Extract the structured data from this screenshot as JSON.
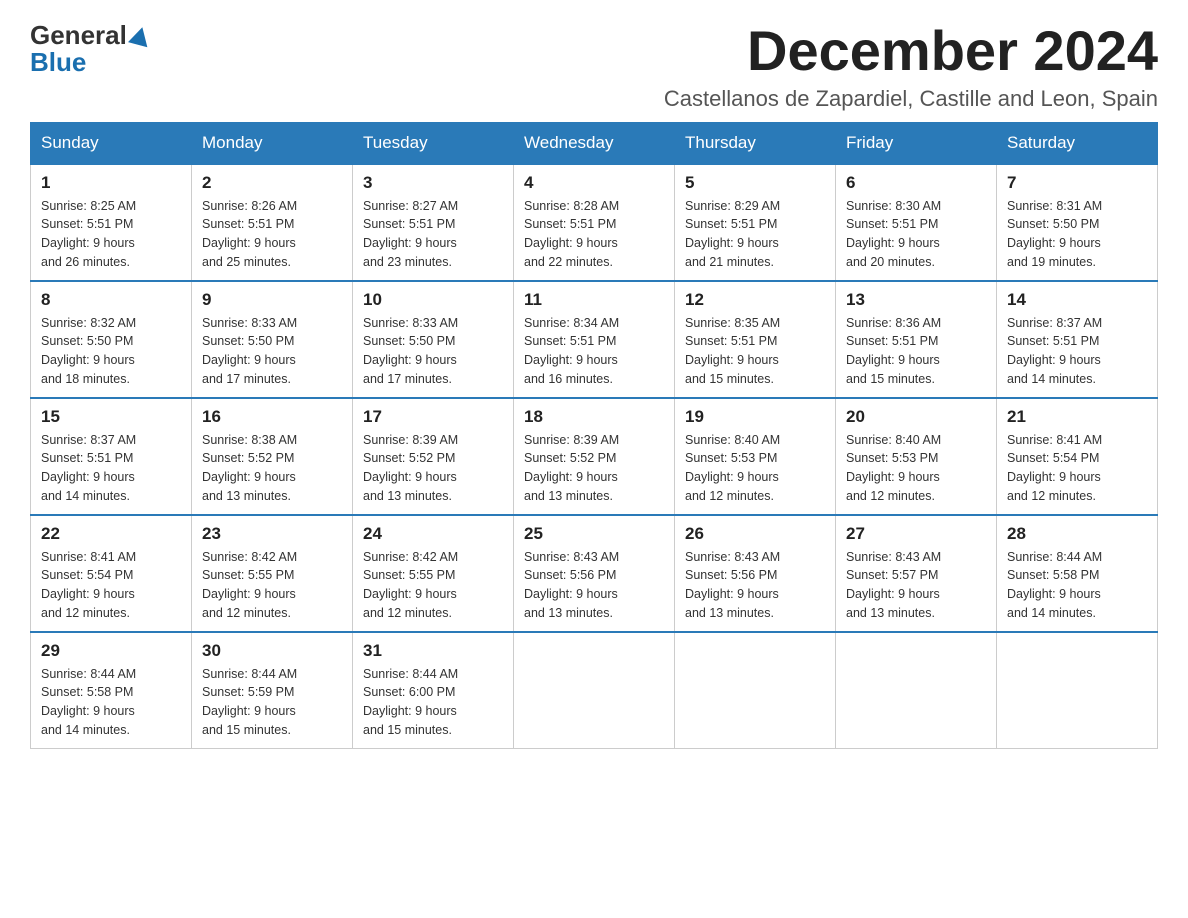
{
  "logo": {
    "general": "General",
    "blue": "Blue"
  },
  "header": {
    "month": "December 2024",
    "location": "Castellanos de Zapardiel, Castille and Leon, Spain"
  },
  "days_of_week": [
    "Sunday",
    "Monday",
    "Tuesday",
    "Wednesday",
    "Thursday",
    "Friday",
    "Saturday"
  ],
  "weeks": [
    [
      {
        "day": "1",
        "sunrise": "8:25 AM",
        "sunset": "5:51 PM",
        "daylight": "9 hours and 26 minutes."
      },
      {
        "day": "2",
        "sunrise": "8:26 AM",
        "sunset": "5:51 PM",
        "daylight": "9 hours and 25 minutes."
      },
      {
        "day": "3",
        "sunrise": "8:27 AM",
        "sunset": "5:51 PM",
        "daylight": "9 hours and 23 minutes."
      },
      {
        "day": "4",
        "sunrise": "8:28 AM",
        "sunset": "5:51 PM",
        "daylight": "9 hours and 22 minutes."
      },
      {
        "day": "5",
        "sunrise": "8:29 AM",
        "sunset": "5:51 PM",
        "daylight": "9 hours and 21 minutes."
      },
      {
        "day": "6",
        "sunrise": "8:30 AM",
        "sunset": "5:51 PM",
        "daylight": "9 hours and 20 minutes."
      },
      {
        "day": "7",
        "sunrise": "8:31 AM",
        "sunset": "5:50 PM",
        "daylight": "9 hours and 19 minutes."
      }
    ],
    [
      {
        "day": "8",
        "sunrise": "8:32 AM",
        "sunset": "5:50 PM",
        "daylight": "9 hours and 18 minutes."
      },
      {
        "day": "9",
        "sunrise": "8:33 AM",
        "sunset": "5:50 PM",
        "daylight": "9 hours and 17 minutes."
      },
      {
        "day": "10",
        "sunrise": "8:33 AM",
        "sunset": "5:50 PM",
        "daylight": "9 hours and 17 minutes."
      },
      {
        "day": "11",
        "sunrise": "8:34 AM",
        "sunset": "5:51 PM",
        "daylight": "9 hours and 16 minutes."
      },
      {
        "day": "12",
        "sunrise": "8:35 AM",
        "sunset": "5:51 PM",
        "daylight": "9 hours and 15 minutes."
      },
      {
        "day": "13",
        "sunrise": "8:36 AM",
        "sunset": "5:51 PM",
        "daylight": "9 hours and 15 minutes."
      },
      {
        "day": "14",
        "sunrise": "8:37 AM",
        "sunset": "5:51 PM",
        "daylight": "9 hours and 14 minutes."
      }
    ],
    [
      {
        "day": "15",
        "sunrise": "8:37 AM",
        "sunset": "5:51 PM",
        "daylight": "9 hours and 14 minutes."
      },
      {
        "day": "16",
        "sunrise": "8:38 AM",
        "sunset": "5:52 PM",
        "daylight": "9 hours and 13 minutes."
      },
      {
        "day": "17",
        "sunrise": "8:39 AM",
        "sunset": "5:52 PM",
        "daylight": "9 hours and 13 minutes."
      },
      {
        "day": "18",
        "sunrise": "8:39 AM",
        "sunset": "5:52 PM",
        "daylight": "9 hours and 13 minutes."
      },
      {
        "day": "19",
        "sunrise": "8:40 AM",
        "sunset": "5:53 PM",
        "daylight": "9 hours and 12 minutes."
      },
      {
        "day": "20",
        "sunrise": "8:40 AM",
        "sunset": "5:53 PM",
        "daylight": "9 hours and 12 minutes."
      },
      {
        "day": "21",
        "sunrise": "8:41 AM",
        "sunset": "5:54 PM",
        "daylight": "9 hours and 12 minutes."
      }
    ],
    [
      {
        "day": "22",
        "sunrise": "8:41 AM",
        "sunset": "5:54 PM",
        "daylight": "9 hours and 12 minutes."
      },
      {
        "day": "23",
        "sunrise": "8:42 AM",
        "sunset": "5:55 PM",
        "daylight": "9 hours and 12 minutes."
      },
      {
        "day": "24",
        "sunrise": "8:42 AM",
        "sunset": "5:55 PM",
        "daylight": "9 hours and 12 minutes."
      },
      {
        "day": "25",
        "sunrise": "8:43 AM",
        "sunset": "5:56 PM",
        "daylight": "9 hours and 13 minutes."
      },
      {
        "day": "26",
        "sunrise": "8:43 AM",
        "sunset": "5:56 PM",
        "daylight": "9 hours and 13 minutes."
      },
      {
        "day": "27",
        "sunrise": "8:43 AM",
        "sunset": "5:57 PM",
        "daylight": "9 hours and 13 minutes."
      },
      {
        "day": "28",
        "sunrise": "8:44 AM",
        "sunset": "5:58 PM",
        "daylight": "9 hours and 14 minutes."
      }
    ],
    [
      {
        "day": "29",
        "sunrise": "8:44 AM",
        "sunset": "5:58 PM",
        "daylight": "9 hours and 14 minutes."
      },
      {
        "day": "30",
        "sunrise": "8:44 AM",
        "sunset": "5:59 PM",
        "daylight": "9 hours and 15 minutes."
      },
      {
        "day": "31",
        "sunrise": "8:44 AM",
        "sunset": "6:00 PM",
        "daylight": "9 hours and 15 minutes."
      },
      null,
      null,
      null,
      null
    ]
  ]
}
